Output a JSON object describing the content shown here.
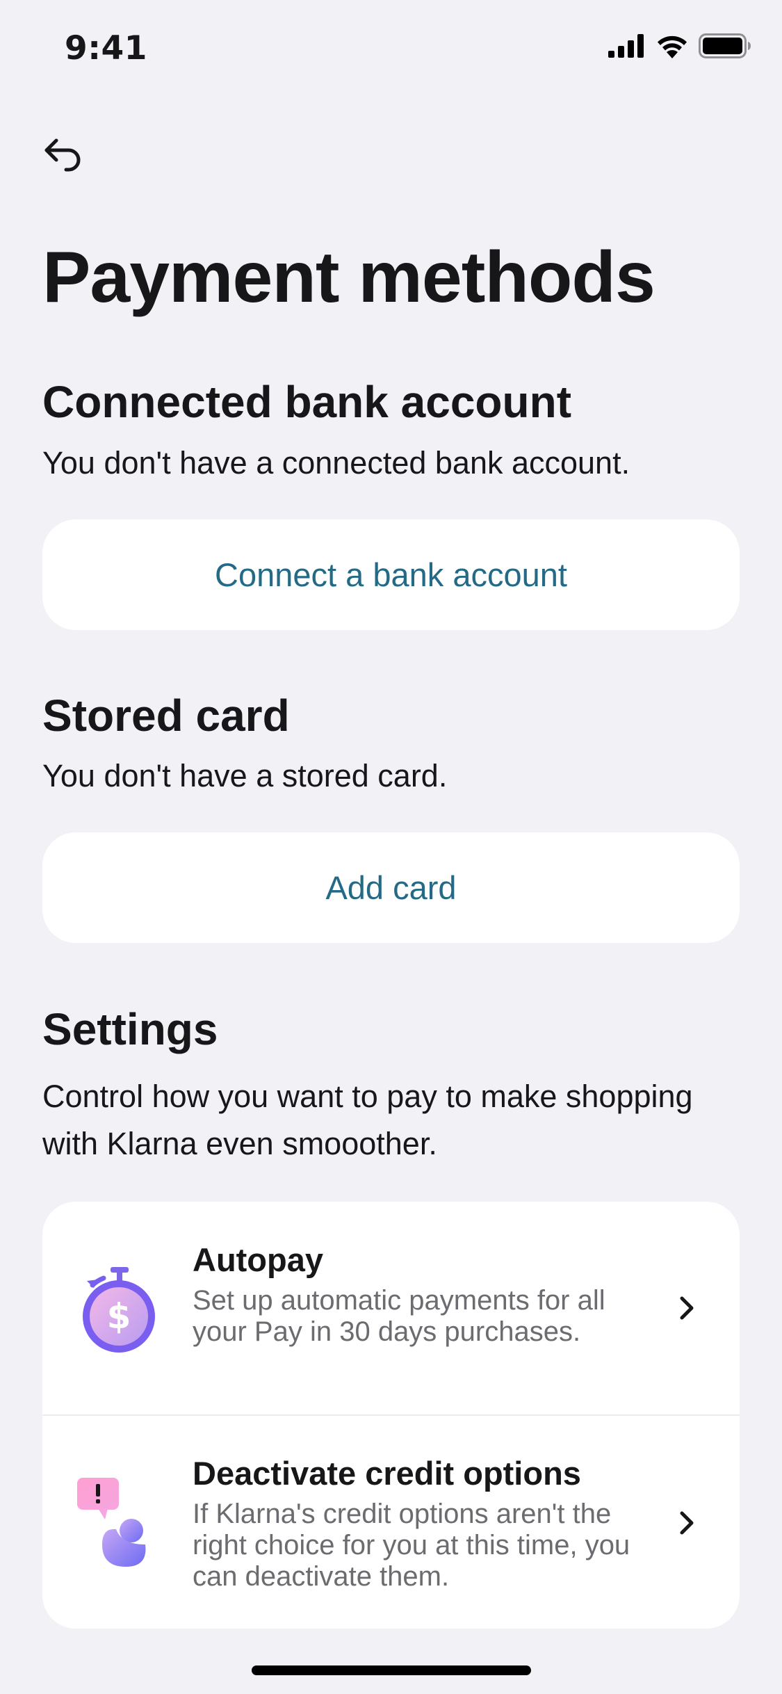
{
  "status_bar": {
    "time": "9:41",
    "icons": [
      "cellular-signal-icon",
      "wifi-icon",
      "battery-icon"
    ]
  },
  "nav": {
    "back_icon": "back-arrow-icon"
  },
  "page": {
    "title": "Payment methods"
  },
  "bank_section": {
    "heading": "Connected bank account",
    "description": "You don't have a connected bank account.",
    "button_label": "Connect a bank account"
  },
  "card_section": {
    "heading": "Stored card",
    "description": "You don't have a stored card.",
    "button_label": "Add card"
  },
  "settings_section": {
    "heading": "Settings",
    "description": "Control how you want to pay to make shopping with Klarna even smooother.",
    "items": [
      {
        "title": "Autopay",
        "description": "Set up automatic payments for all your Pay in 30 days purchases.",
        "icon": "stopwatch-dollar-icon"
      },
      {
        "title": "Deactivate credit options",
        "description": "If Klarna's credit options aren't the right choice for you at this time, you can deactivate them.",
        "icon": "person-alert-icon"
      }
    ]
  },
  "colors": {
    "background": "#f1f1f6",
    "card": "#ffffff",
    "link": "#246a86",
    "text": "#17171a",
    "secondary_text": "#6b6b70"
  }
}
